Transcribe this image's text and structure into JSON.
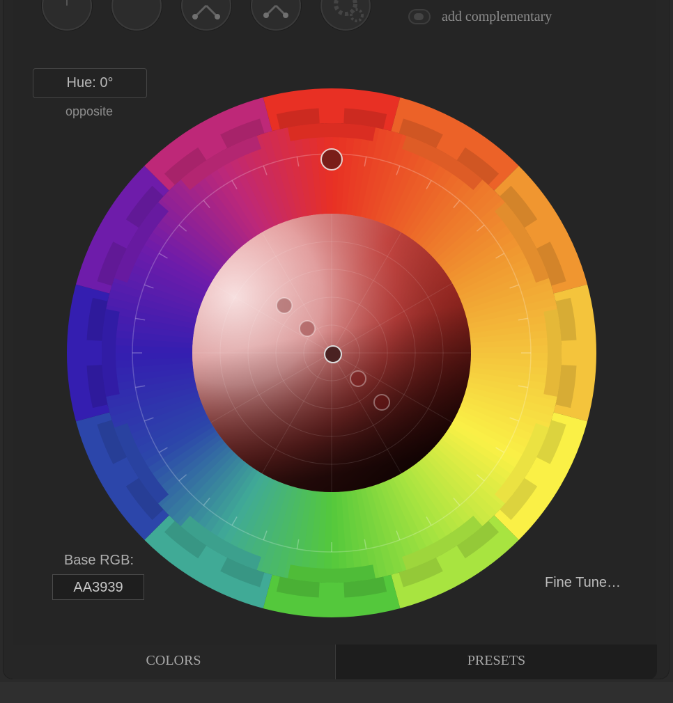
{
  "toolbar": {
    "mode_icons": [
      {
        "name": "mono-mode-icon"
      },
      {
        "name": "contrast-mode-icon"
      },
      {
        "name": "triad-mode-icon"
      },
      {
        "name": "tetrad-mode-icon"
      },
      {
        "name": "analogic-mode-icon"
      }
    ],
    "complementary_label": "add complementary",
    "complementary_on": false
  },
  "hue": {
    "label": "Hue: 0°",
    "sub": "opposite",
    "value_deg": 0
  },
  "base_rgb": {
    "label": "Base RGB:",
    "value": "AA3939"
  },
  "fine_tune": "Fine Tune…",
  "tabs": [
    {
      "label": "COLORS",
      "active": true
    },
    {
      "label": "PRESETS",
      "active": false
    }
  ],
  "colors": {
    "base": "#AA3939",
    "panel": "#252525"
  }
}
